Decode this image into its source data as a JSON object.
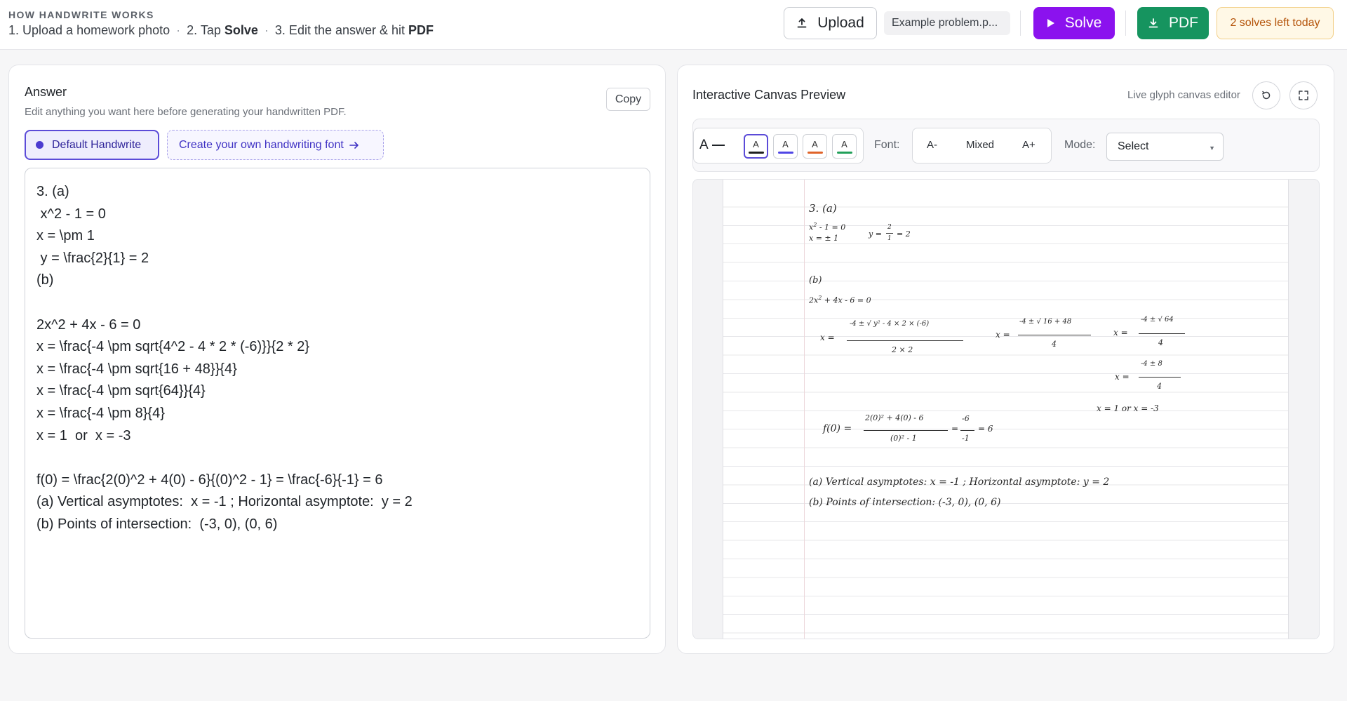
{
  "header": {
    "how_title": "HOW HANDWRITE WORKS",
    "step1": "1. Upload a homework photo",
    "step2_prefix": "2. Tap",
    "step2_bold": "Solve",
    "step3_prefix": "3. Edit the answer & hit",
    "step3_bold": "PDF",
    "separator": "·",
    "upload_label": "Upload",
    "upload_icon": "upload-icon",
    "file_name": "Example problem.p...",
    "solve_label": "Solve",
    "solve_icon": "play-icon",
    "pdf_label": "PDF",
    "pdf_icon": "download-icon",
    "solves_left": "2 solves left today",
    "colors": {
      "solve": "#8b12ee",
      "pdf": "#16945f",
      "badge_text": "#b45309"
    }
  },
  "answer_panel": {
    "title": "Answer",
    "subtitle": "Edit anything you want here before generating your handwritten PDF.",
    "copy_label": "Copy",
    "font_default_label": "Default Handwrite",
    "font_create_label": "Create your own handwriting font",
    "font_create_icon": "arrow-right-icon",
    "answer_text": "3. (a)\n x^2 - 1 = 0\nx = \\pm 1\n y = \\frac{2}{1} = 2\n(b)\n\n2x^2 + 4x - 6 = 0\nx = \\frac{-4 \\pm sqrt{4^2 - 4 * 2 * (-6)}}{2 * 2}\nx = \\frac{-4 \\pm sqrt{16 + 48}}{4}\nx = \\frac{-4 \\pm sqrt{64}}{4}\nx = \\frac{-4 \\pm 8}{4}\nx = 1  or  x = -3\n\nf(0) = \\frac{2(0)^2 + 4(0) - 6}{(0)^2 - 1} = \\frac{-6}{-1} = 6\n(a) Vertical asymptotes:  x = -1 ; Horizontal asymptote:  y = 2\n(b) Points of intersection:  (-3, 0), (0, 6)"
  },
  "canvas_panel": {
    "title": "Interactive Canvas Preview",
    "live_label": "Live glyph canvas editor",
    "reset_icon": "rotate-ccw-icon",
    "fullscreen_icon": "fullscreen-icon",
    "toolbar": {
      "a_label": "A",
      "swatch_letter": "A",
      "swatches": [
        {
          "name": "black",
          "color": "#1f1f1f"
        },
        {
          "name": "blue",
          "color": "#4f46e5"
        },
        {
          "name": "orange",
          "color": "#e0642a"
        },
        {
          "name": "green",
          "color": "#22a05a"
        }
      ],
      "font_label": "Font:",
      "font_smaller": "A-",
      "font_mixed": "Mixed",
      "font_larger": "A+",
      "mode_label": "Mode:",
      "mode_value": "Select"
    },
    "handwriting": {
      "l1": "3. (a)",
      "l2a": "x",
      "l2a_sup": "2",
      "l2b": "- 1 = 0",
      "l3": "x = ± 1",
      "y_lhs": "y =",
      "y_num": "2",
      "y_den": "1",
      "y_rhs": "= 2",
      "b": "(b)",
      "q_a": "2x",
      "q_sup": "2",
      "q_b": "+ 4x - 6 = 0",
      "x_eq": "x =",
      "f1_num": "-4 ± √ y² - 4 × 2 × (-6)",
      "f1_den": "2 × 2",
      "f2_num": "-4 ± √ 16 + 48",
      "f2_den": "4",
      "f3_num": "-4 ± √ 64",
      "f3_den": "4",
      "f4_num": "-4 ± 8",
      "f4_den": "4",
      "roots": "x = 1   or   x = -3",
      "f0_lhs": "f(0) =",
      "f0_num": "2(0)² + 4(0) - 6",
      "f0_den": "(0)² - 1",
      "f0_eq": "=",
      "f0_num2": "-6",
      "f0_den2": "-1",
      "f0_rhs": "= 6",
      "asym": "(a) Vertical asymptotes:  x = -1 ; Horizontal asymptote:  y = 2",
      "points": "(b) Points of intersection:  (-3, 0), (0, 6)"
    }
  }
}
